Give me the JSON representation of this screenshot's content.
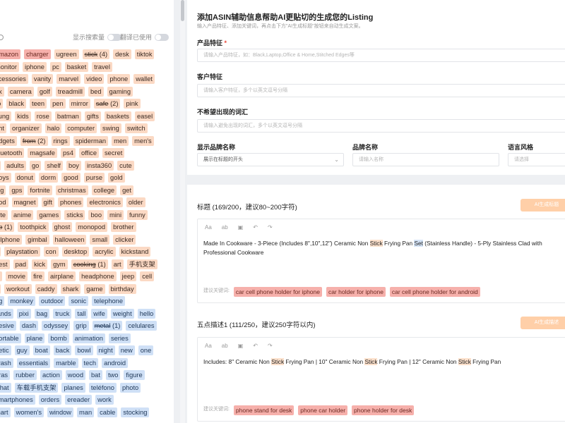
{
  "sidebar": {
    "toggle1": "显示搜索量",
    "toggle2": "翻译已使用",
    "rows": [
      [
        [
          "r",
          "amazon"
        ],
        [
          "r",
          "charger"
        ],
        [
          "o",
          "ugreen"
        ],
        [
          "os",
          "stick",
          "(4)"
        ],
        [
          "o",
          "desk"
        ],
        [
          "o",
          "tiktok"
        ]
      ],
      [
        [
          "o",
          "monitor"
        ],
        [
          "o",
          "iphone"
        ],
        [
          "o",
          "pc"
        ],
        [
          "o",
          "basket"
        ],
        [
          "o",
          "travel"
        ]
      ],
      [
        [
          "o",
          "ccessories"
        ],
        [
          "o",
          "vanity"
        ],
        [
          "o",
          "marvel"
        ],
        [
          "o",
          "video"
        ],
        [
          "o",
          "phone"
        ],
        [
          "o",
          "wallet"
        ]
      ],
      [
        [
          "o",
          "ax"
        ],
        [
          "o",
          "camera"
        ],
        [
          "o",
          "golf"
        ],
        [
          "o",
          "treadmill"
        ],
        [
          "o",
          "bed"
        ],
        [
          "o",
          "gaming"
        ]
      ],
      [
        [
          "o",
          "ro"
        ],
        [
          "o",
          "black"
        ],
        [
          "o",
          "teen"
        ],
        [
          "o",
          "pen"
        ],
        [
          "o",
          "mirror"
        ],
        [
          "os",
          "safe",
          "(2)"
        ],
        [
          "o",
          "pink"
        ]
      ],
      [
        [
          "o",
          "sung"
        ],
        [
          "o",
          "kids"
        ],
        [
          "o",
          "rose"
        ],
        [
          "o",
          "batman"
        ],
        [
          "o",
          "gifts"
        ],
        [
          "o",
          "baskets"
        ],
        [
          "o",
          "easel"
        ]
      ],
      [
        [
          "o",
          "ght"
        ],
        [
          "o",
          "organizer"
        ],
        [
          "o",
          "halo"
        ],
        [
          "o",
          "computer"
        ],
        [
          "o",
          "swing"
        ],
        [
          "o",
          "switch"
        ]
      ],
      [
        [
          "o",
          "adgets"
        ],
        [
          "os",
          "from",
          "(2)"
        ],
        [
          "o",
          "rings"
        ],
        [
          "o",
          "spiderman"
        ],
        [
          "o",
          "men"
        ],
        [
          "o",
          "men's"
        ]
      ],
      [
        [
          "o",
          "bluetooth"
        ],
        [
          "o",
          "magsafe"
        ],
        [
          "o",
          "ps4"
        ],
        [
          "o",
          "office"
        ],
        [
          "o",
          "secret"
        ]
      ],
      [
        [
          "o",
          "e"
        ],
        [
          "o",
          "adults"
        ],
        [
          "o",
          "go"
        ],
        [
          "o",
          "shelf"
        ],
        [
          "o",
          "boy"
        ],
        [
          "o",
          "insta360"
        ],
        [
          "o",
          "cute"
        ]
      ],
      [
        [
          "o",
          "boys"
        ],
        [
          "o",
          "donut"
        ],
        [
          "o",
          "dorm"
        ],
        [
          "o",
          "good"
        ],
        [
          "o",
          "purse"
        ],
        [
          "o",
          "gold"
        ]
      ],
      [
        [
          "o",
          "ing"
        ],
        [
          "o",
          "gps"
        ],
        [
          "o",
          "fortnite"
        ],
        [
          "o",
          "christmas"
        ],
        [
          "o",
          "college"
        ],
        [
          "o",
          "get"
        ]
      ],
      [
        [
          "o",
          "pod"
        ],
        [
          "o",
          "magnet"
        ],
        [
          "o",
          "gift"
        ],
        [
          "o",
          "phones"
        ],
        [
          "o",
          "electronics"
        ],
        [
          "o",
          "older"
        ]
      ],
      [
        [
          "o",
          "hite"
        ],
        [
          "o",
          "anime"
        ],
        [
          "o",
          "games"
        ],
        [
          "o",
          "sticks"
        ],
        [
          "o",
          "boo"
        ],
        [
          "o",
          "mini"
        ],
        [
          "o",
          "funny"
        ]
      ],
      [
        [
          "os",
          "up",
          "(1)"
        ],
        [
          "o",
          "toothpick"
        ],
        [
          "o",
          "ghost"
        ],
        [
          "o",
          "monopod"
        ],
        [
          "o",
          "brother"
        ]
      ],
      [
        [
          "o",
          "ellphone"
        ],
        [
          "o",
          "gimbal"
        ],
        [
          "o",
          "halloween"
        ],
        [
          "o",
          "small"
        ],
        [
          "o",
          "clicker"
        ]
      ],
      [
        [
          "o",
          "n"
        ],
        [
          "o",
          "playstation"
        ],
        [
          "o",
          "con"
        ],
        [
          "o",
          "desktop"
        ],
        [
          "o",
          "acrylic"
        ],
        [
          "o",
          "kickstand"
        ]
      ],
      [
        [
          "o",
          "best"
        ],
        [
          "o",
          "pad"
        ],
        [
          "o",
          "kick"
        ],
        [
          "o",
          "gym"
        ],
        [
          "os",
          "cooking",
          "(1)"
        ],
        [
          "o",
          "art"
        ],
        [
          "o",
          "手机支架"
        ]
      ],
      [
        [
          "o",
          "le"
        ],
        [
          "o",
          "movie"
        ],
        [
          "o",
          "fire"
        ],
        [
          "o",
          "airplane"
        ],
        [
          "o",
          "headphone"
        ],
        [
          "o",
          "jeep"
        ],
        [
          "o",
          "cell"
        ]
      ],
      [
        [
          "o",
          "n"
        ],
        [
          "o",
          "workout"
        ],
        [
          "o",
          "caddy"
        ],
        [
          "o",
          "shark"
        ],
        [
          "o",
          "game"
        ],
        [
          "o",
          "birthday"
        ]
      ],
      [
        [
          "b",
          "ng"
        ],
        [
          "b",
          "monkey"
        ],
        [
          "b",
          "outdoor"
        ],
        [
          "b",
          "sonic"
        ],
        [
          "b",
          "telephone"
        ]
      ],
      [
        [
          "b",
          "tands"
        ],
        [
          "b",
          "pixi"
        ],
        [
          "b",
          "bag"
        ],
        [
          "b",
          "truck"
        ],
        [
          "b",
          "tall"
        ],
        [
          "b",
          "wife"
        ],
        [
          "b",
          "weight"
        ],
        [
          "b",
          "hello"
        ]
      ],
      [
        [
          "b",
          "hesive"
        ],
        [
          "b",
          "dash"
        ],
        [
          "b",
          "odyssey"
        ],
        [
          "b",
          "grip"
        ],
        [
          "bs",
          "metal",
          "(1)"
        ],
        [
          "b",
          "celulares"
        ]
      ],
      [
        [
          "b",
          "portable"
        ],
        [
          "b",
          "plane"
        ],
        [
          "b",
          "bomb"
        ],
        [
          "b",
          "animation"
        ],
        [
          "b",
          "series"
        ]
      ],
      [
        [
          "b",
          "netic"
        ],
        [
          "b",
          "guy"
        ],
        [
          "b",
          "boat"
        ],
        [
          "b",
          "back"
        ],
        [
          "b",
          "bowl"
        ],
        [
          "b",
          "night"
        ],
        [
          "b",
          "new"
        ],
        [
          "b",
          "one"
        ]
      ],
      [
        [
          "b",
          "crash"
        ],
        [
          "b",
          "essentials"
        ],
        [
          "b",
          "marble"
        ],
        [
          "b",
          "tech"
        ],
        [
          "b",
          "android"
        ]
      ],
      [
        [
          "b",
          "aras"
        ],
        [
          "b",
          "rubber"
        ],
        [
          "b",
          "action"
        ],
        [
          "b",
          "wood"
        ],
        [
          "b",
          "bat"
        ],
        [
          "b",
          "two"
        ],
        [
          "b",
          "figure"
        ]
      ],
      [
        [
          "b",
          "what"
        ],
        [
          "b",
          "车载手机支架"
        ],
        [
          "b",
          "planes"
        ],
        [
          "b",
          "teléfono"
        ],
        [
          "b",
          "photo"
        ]
      ],
      [
        [
          "b",
          "smartphones"
        ],
        [
          "b",
          "orders"
        ],
        [
          "b",
          "ereader"
        ],
        [
          "b",
          "work"
        ]
      ],
      [
        [
          "b",
          "mart"
        ],
        [
          "b",
          "women's"
        ],
        [
          "b",
          "window"
        ],
        [
          "b",
          "man"
        ],
        [
          "b",
          "cable"
        ],
        [
          "b",
          "stocking"
        ]
      ]
    ]
  },
  "form": {
    "title": "添加ASIN辅助信息帮助AI更贴切的生成您的Listing",
    "subtitle": "输入产品特征、添加关键词，再点击下方\"AI生成标题\"按钮来自动生成文案。",
    "feature_label": "产品特征",
    "feature_req": "*",
    "feature_placeholder": "请输入产品特征，如：Black,Laptop,Office & Home,Stitched Edges等",
    "customer_label": "客户特征",
    "customer_placeholder": "请输入客户特征，多个以英文逗号分隔",
    "exclude_label": "不希望出现的词汇",
    "exclude_placeholder": "请输入避免出现的词汇，多个以英文逗号分隔",
    "brand_display_label": "显示品牌名称",
    "brand_display_value": "展示在标题的开头",
    "brand_name_label": "品牌名称",
    "brand_name_placeholder": "请输入名称",
    "lang_label": "语言风格",
    "lang_placeholder": "请选择"
  },
  "listing": {
    "title_section": "标题 (169/200，建议80~200字符)",
    "ai_title_btn": "AI生成标题",
    "toolbar": [
      "Aa",
      "ab",
      "▣",
      "↶",
      "↷"
    ],
    "title_text_1": "Made In Cookware - 3-Piece (Includes 8\",10\",12\") Ceramic Non ",
    "title_hl_1": "Stick",
    "title_text_2": " Frying Pan ",
    "title_hl_2": "Set",
    "title_text_3": " (Stainless Handle) - 5-Ply Stainless Clad with Professional Cookware",
    "suggest_label": "建议关键词:",
    "title_keywords": [
      "car cell phone holder for iphone",
      "car holder for iphone",
      "car cell phone holder for android"
    ],
    "bullet_section": "五点描述1 (111/250，建议250字符以内)",
    "ai_bullet_btn": "AI生成描述",
    "bullet_text_1": "Includes: 8\" Ceramic Non ",
    "bullet_hl_1": "Stick",
    "bullet_text_2": " Frying Pan | 10\" Ceramic Non ",
    "bullet_hl_2": "Stick",
    "bullet_text_3": " Frying Pan | 12\" Ceramic Non ",
    "bullet_hl_3": "Stick",
    "bullet_text_4": " Frying Pan",
    "bullet_keywords": [
      "phone stand for desk",
      "phone car holder",
      "phone holder for desk"
    ]
  }
}
